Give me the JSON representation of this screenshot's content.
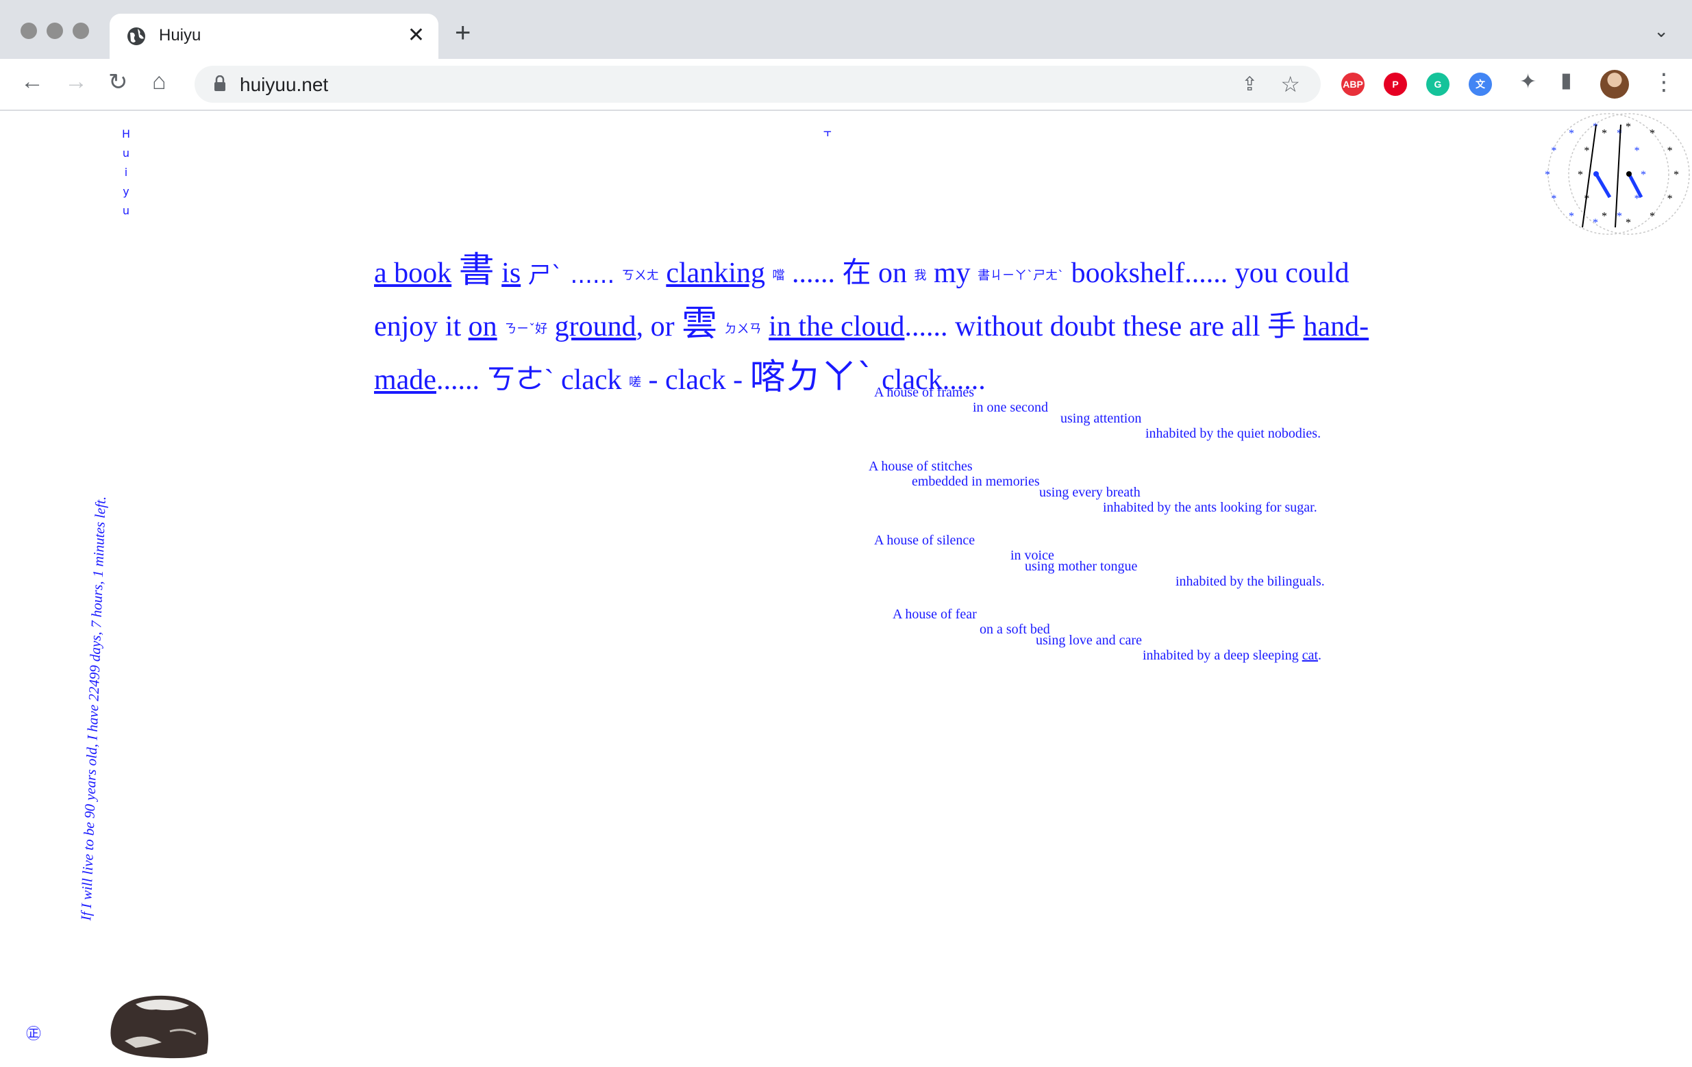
{
  "browser": {
    "tab_title": "Huiyu",
    "tab_close": "✕",
    "new_tab": "+",
    "tab_menu": "⌄",
    "url": "huiyuu.net",
    "nav": {
      "back": "←",
      "forward": "→",
      "reload": "↻",
      "home": "⌂"
    },
    "share": "⇪",
    "star": "☆",
    "extensions": [
      {
        "name": "abp-extension-icon",
        "label": "ABP",
        "color": "#e8303a"
      },
      {
        "name": "pinterest-extension-icon",
        "label": "P",
        "color": "#e60023"
      },
      {
        "name": "grammarly-extension-icon",
        "label": "G",
        "color": "#15c39a"
      },
      {
        "name": "translate-extension-icon",
        "label": "文",
        "color": "#4285f4"
      }
    ],
    "puzzle": "✦",
    "sidepanel": "▮",
    "menu": "⋮"
  },
  "page": {
    "vertical_name": [
      "H",
      "u",
      "i",
      "y",
      "u"
    ],
    "top_mark": "⫟",
    "main": {
      "t1": "a book",
      "t2": "書",
      "t3": "is",
      "t4": "ㄕˋ ......",
      "t5": "ㄎㄨㄤ",
      "t6": "clanking",
      "t7": "噹",
      "t8": "...... 在 on",
      "t9": "我",
      "t10": "my",
      "t11": "書ㄐㄧㄚˋㄕㄤˋ",
      "t12": "bookshelf...... you could enjoy it",
      "t13": "on",
      "t14": "ㄋㄧˇ好",
      "t15": "ground",
      "t16": ", or",
      "t17": "雲",
      "t18": "ㄉㄨㄢ",
      "t19": "in the cloud",
      "t20": "...... without doubt these are all 手",
      "t21": "hand-made",
      "t22": "...... ㄎㄜˋ clack",
      "t23": "嗟",
      "t24": "- clack -",
      "t25": "喀ㄉㄚˋ",
      "t26": "clack......"
    },
    "poems": [
      {
        "l1": "A house of frames",
        "l2": "in one second",
        "l3": "using attention",
        "l4": "inhabited by the quiet nobodies."
      },
      {
        "l1": "A house of stitches",
        "l2": "embedded in memories",
        "l3": "using every breath",
        "l4": "inhabited by the ants looking for sugar."
      },
      {
        "l1": "A house of silence",
        "l2": "in voice",
        "l3": "using mother tongue",
        "l4": "inhabited by the bilinguals."
      },
      {
        "l1": "A house of fear",
        "l2": "on a soft bed",
        "l3": "using love and care",
        "l4a": "inhabited by a deep sleeping ",
        "l4b": "cat",
        "l4c": "."
      }
    ],
    "lifeline": "If I will live to be 90 years old, I have 22499 days, 7 hours, 1 minutes left.",
    "foot_icon": "㊣"
  },
  "colors": {
    "accent": "#1a1aff",
    "chrome": "#dee1e6"
  }
}
